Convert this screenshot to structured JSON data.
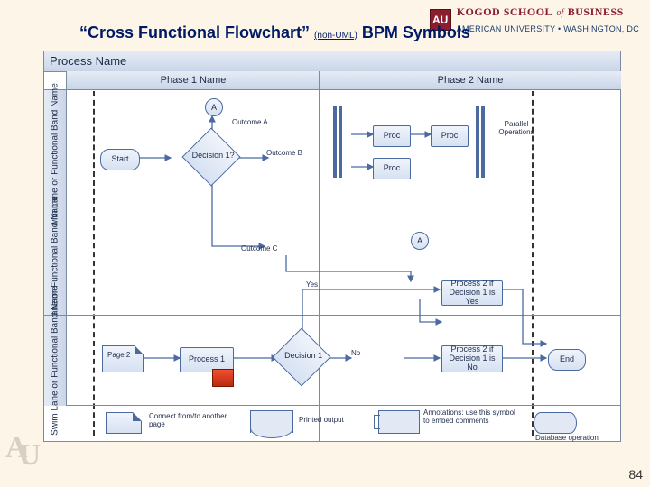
{
  "brand": {
    "logo_initials": "AU",
    "school": "KOGOD SCHOOL",
    "of": "of",
    "school2": "BUSINESS",
    "university": "AMERICAN UNIVERSITY • WASHINGTON, DC"
  },
  "title": {
    "quoted": "“Cross Functional Flowchart”",
    "sub": "(non-UML)",
    "tail": " BPM Symbols"
  },
  "watermark": {
    "a": "A",
    "u": "U"
  },
  "page_number": "84",
  "chart": {
    "process_name": "Process Name",
    "phases": [
      "Phase 1 Name",
      "Phase 2 Name"
    ],
    "lanes": [
      "Swim Lane or Functional Band Name",
      "Swim Lane or Functional Band Name",
      "Swim Lane or Functional Band Name"
    ],
    "nodes": {
      "start": "Start",
      "decision1q": "Decision 1?",
      "circ_a_top": "A",
      "outcome_a": "Outcome A",
      "outcome_b": "Outcome B",
      "outcome_c": "Outcome C",
      "proc1": "Proc",
      "proc2": "Proc",
      "proc3": "Proc",
      "proc4": "Proc",
      "parallel_lbl": "Parallel Operations",
      "circ_a_mid": "A",
      "yes": "Yes",
      "no": "No",
      "page2": "Page 2",
      "process1": "Process 1",
      "decision1": "Decision 1",
      "proc2yes": "Process 2 if Decision 1 is Yes",
      "proc2no": "Process 2 if Decision 1 is No",
      "end": "End"
    },
    "legend": {
      "connect": "Connect from/to another page",
      "printed": "Printed output",
      "annotations": "Annotations: use this symbol to embed comments",
      "database": "Database operation"
    }
  }
}
